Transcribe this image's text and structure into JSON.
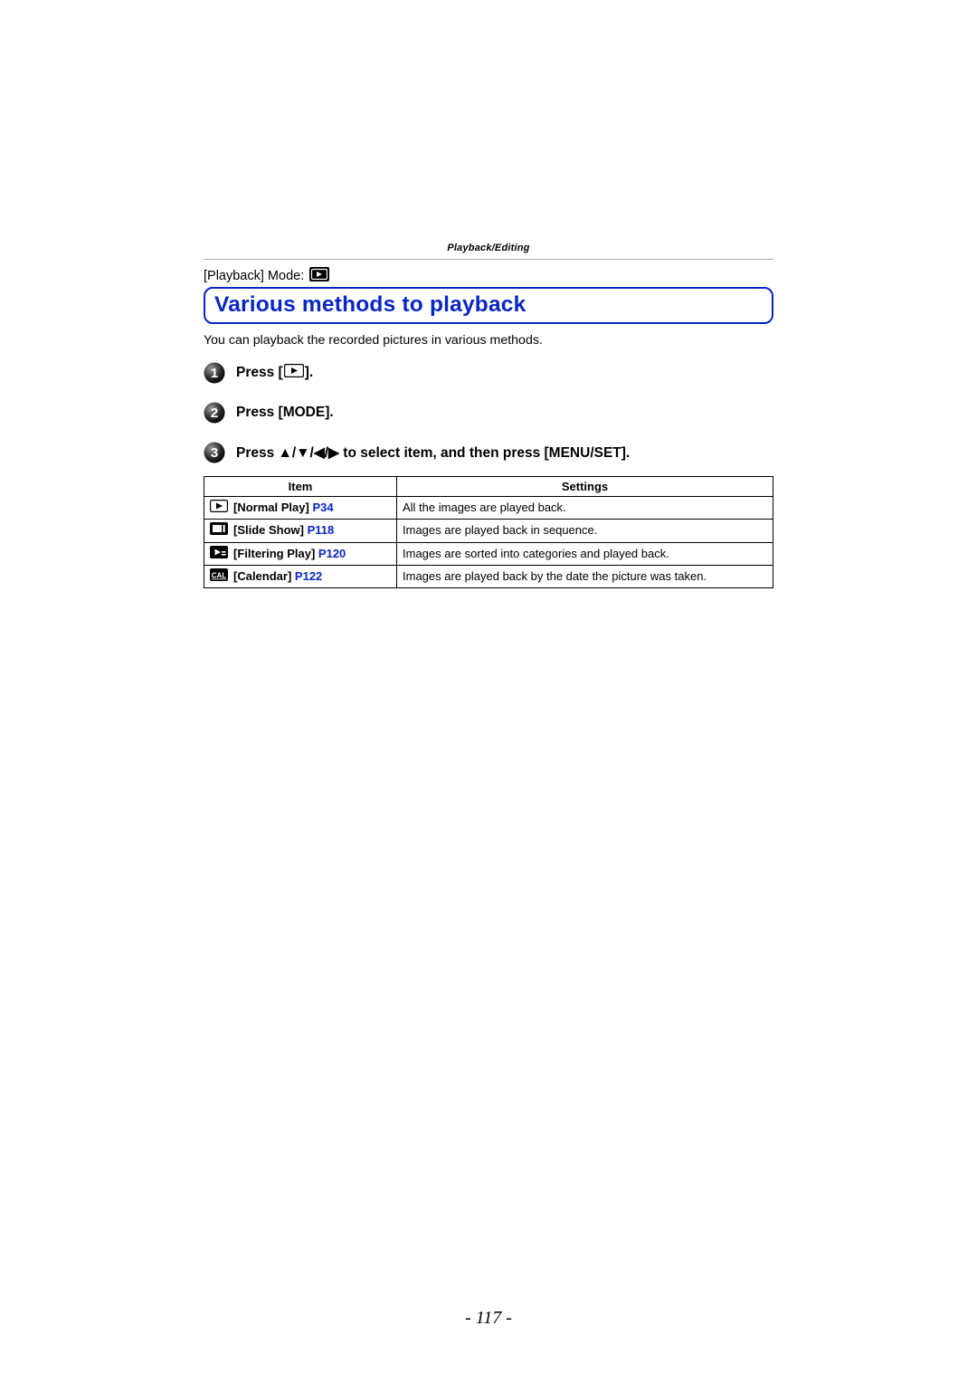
{
  "header_sub": "Playback/Editing",
  "mode_line_text": "[Playback] Mode:",
  "title": "Various methods to playback",
  "intro": "You can playback the recorded pictures in various methods.",
  "steps": [
    {
      "prefix": "Press [",
      "mid": "playback-icon",
      "suffix": "]."
    },
    {
      "text": "Press [MODE]."
    },
    {
      "text": "Press ▲/▼/◀/▶ to select item, and then press [MENU/SET]."
    }
  ],
  "table": {
    "headers": {
      "item": "Item",
      "settings": "Settings"
    },
    "rows": [
      {
        "label": "[Normal Play]",
        "ref": "P34",
        "settings": "All the images are played back."
      },
      {
        "label": "[Slide Show]",
        "ref": "P118",
        "settings": "Images are played back in sequence."
      },
      {
        "label": "[Filtering Play]",
        "ref": "P120",
        "settings": "Images are sorted into categories and played back."
      },
      {
        "label": "[Calendar]",
        "ref": "P122",
        "settings": "Images are played back by the date the picture was taken."
      }
    ]
  },
  "page_number": "- 117 -"
}
